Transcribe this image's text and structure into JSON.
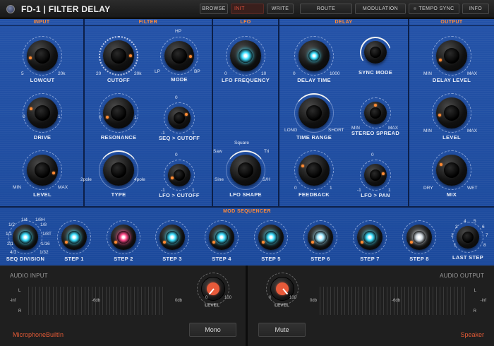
{
  "app": {
    "title": "FD-1 | FILTER DELAY"
  },
  "toolbar": {
    "browse": "BROWSE",
    "preset": "INIT",
    "write": "WRITE",
    "route": "ROUTE",
    "modulation": "MODULATION",
    "tempo_sync": "TEMPO SYNC",
    "info": "INFO"
  },
  "colors": {
    "panel_blue": "#1f4ea2",
    "accent_orange": "#ff8a3a",
    "cyan_led": "#3fe0ff",
    "pink_led": "#ff4a8a",
    "input_knob": "#e85a3a"
  },
  "sections": {
    "input": "INPUT",
    "filter": "FILTER",
    "lfo": "LFO",
    "delay": "DELAY",
    "output": "OUTPUT",
    "sequencer": "MOD SEQUENCER"
  },
  "input": {
    "lowcut": {
      "label": "LOWCUT",
      "min": "5",
      "max": "20k"
    },
    "drive": {
      "label": "DRIVE",
      "min": "0",
      "max": "1"
    },
    "level": {
      "label": "LEVEL",
      "min": "MIN",
      "max": "MAX"
    }
  },
  "filter": {
    "cutoff": {
      "label": "CUTOFF",
      "min": "20",
      "max": "20k"
    },
    "mode": {
      "label": "MODE",
      "top": "HP",
      "left": "LP",
      "right": "BP"
    },
    "resonance": {
      "label": "RESONANCE",
      "min": "0",
      "max": "1"
    },
    "seq_cutoff": {
      "label": "SEQ > CUTOFF",
      "top": "0",
      "min": "-1",
      "max": "1"
    },
    "type": {
      "label": "TYPE",
      "min": "2pole",
      "max": "4pole"
    },
    "lfo_cutoff": {
      "label": "LFO > CUTOFF",
      "top": "0",
      "min": "-1",
      "max": "1"
    }
  },
  "lfo": {
    "frequency": {
      "label": "LFO FREQUENCY",
      "min": "0",
      "max": "10"
    },
    "shape": {
      "label": "LFO SHAPE",
      "top": "Square",
      "left_top": "Saw",
      "right_top": "Tri",
      "left_bottom": "Sine",
      "right_bottom": "S/H"
    }
  },
  "delay": {
    "time": {
      "label": "DELAY TIME",
      "min": "0",
      "max": "1000"
    },
    "sync_mode": {
      "label": "SYNC MODE"
    },
    "time_range": {
      "label": "TIME RANGE",
      "min": "LONG",
      "max": "SHORT"
    },
    "stereo_spread": {
      "label": "STEREO SPREAD",
      "min": "MIN",
      "max": "MAX"
    },
    "feedback": {
      "label": "FEEDBACK",
      "min": "0",
      "max": "1"
    },
    "lfo_pan": {
      "label": "LFO > PAN",
      "top": "0",
      "min": "-1",
      "max": "1"
    }
  },
  "output": {
    "delay_level": {
      "label": "DELAY LEVEL",
      "min": "MIN",
      "max": "MAX"
    },
    "level": {
      "label": "LEVEL",
      "min": "MIN",
      "max": "MAX"
    },
    "mix": {
      "label": "MIX",
      "min": "DRY",
      "max": "WET"
    }
  },
  "sequencer": {
    "division": {
      "label": "SEQ DIVISION",
      "values": [
        "1/4",
        "1/8H",
        "1/2",
        "1/8",
        "1/1",
        "1/8T",
        "2/1",
        "1/16",
        "4/1",
        "1/32"
      ]
    },
    "steps": [
      "STEP 1",
      "STEP 2",
      "STEP 3",
      "STEP 4",
      "STEP 5",
      "STEP 6",
      "STEP 7",
      "STEP 8"
    ],
    "last_step": {
      "label": "LAST STEP",
      "values": [
        "4",
        "5",
        "3",
        "6",
        "2",
        "7",
        "1",
        "8"
      ]
    }
  },
  "audio_input": {
    "title": "AUDIO INPUT",
    "ch_l": "L",
    "ch_r": "R",
    "scale": [
      "-inf",
      "-6db",
      "0db"
    ],
    "knob_label": "LEVEL",
    "knob_min": "0",
    "knob_max": "100",
    "button": "Mono",
    "device": "MicrophoneBuiltIn"
  },
  "audio_output": {
    "title": "AUDIO OUTPUT",
    "ch_l": "L",
    "ch_r": "R",
    "scale": [
      "0db",
      "-6db",
      "-inf"
    ],
    "knob_label": "LEVEL",
    "knob_min": "0",
    "knob_max": "100",
    "button": "Mute",
    "device": "Speaker"
  }
}
